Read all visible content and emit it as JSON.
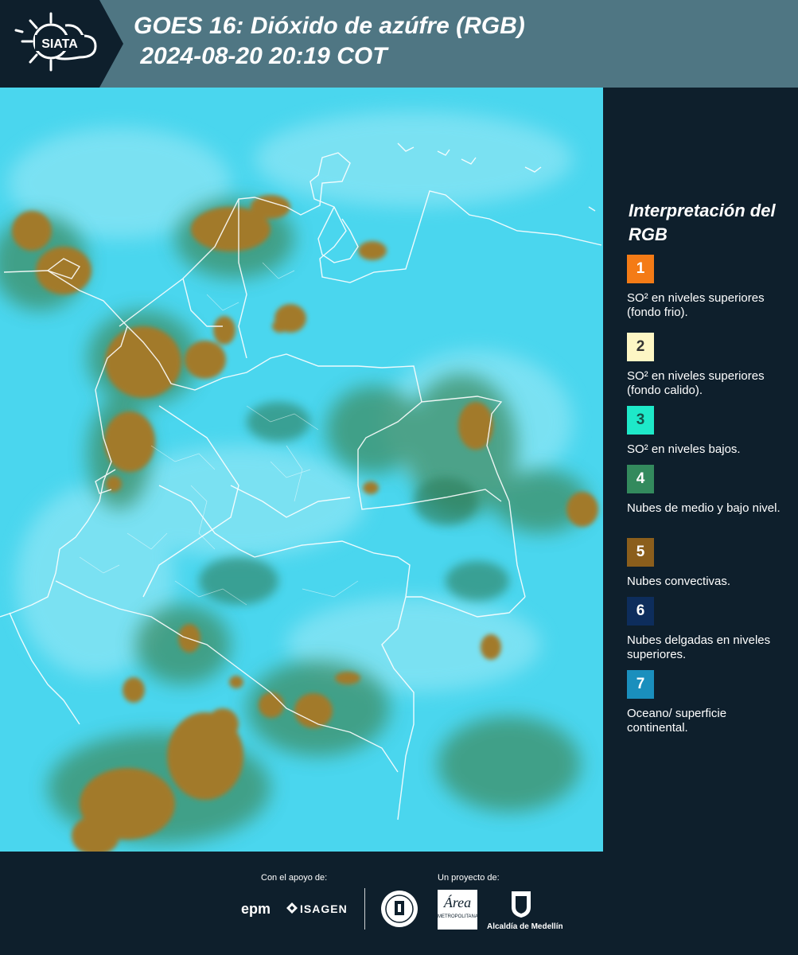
{
  "header": {
    "logo_text": "SIATA",
    "title": "GOES 16: Dióxido de azúfre (RGB)\n 2024-08-20 20:19 COT"
  },
  "colors": {
    "header_bg": "#4f7683",
    "panel_bg": "#0e1f2c",
    "map_cyan": "#4ad6ee",
    "convective": "#a27a2a",
    "low_clouds": "#3d8e66"
  },
  "legend": {
    "title": "Interpretación del RGB",
    "items": [
      {
        "number": "1",
        "color": "#f47b16",
        "text": "SO² en niveles superiores (fondo frio)."
      },
      {
        "number": "2",
        "color": "#fdf6c4",
        "text": "SO² en niveles superiores (fondo calido)."
      },
      {
        "number": "3",
        "color": "#1ee9c9",
        "text": "SO² en niveles bajos."
      },
      {
        "number": "4",
        "color": "#338a5d",
        "text": "Nubes de medio y bajo nivel."
      },
      {
        "number": "5",
        "color": "#8b5e1c",
        "text": "Nubes convectivas."
      },
      {
        "number": "6",
        "color": "#0d2d5c",
        "text": "Nubes delgadas en niveles superiores."
      },
      {
        "number": "7",
        "color": "#1a8fbd",
        "text": "Oceano/ superficie continental."
      }
    ]
  },
  "footer": {
    "support_label": "Con el apoyo de:",
    "project_label": "Un proyecto de:",
    "sponsor_epm": "epm",
    "sponsor_isagen": "ISAGEN",
    "area_label": "Área",
    "area_sub": "METROPOLITANA",
    "alcaldia": "Alcaldía de Medellín"
  }
}
